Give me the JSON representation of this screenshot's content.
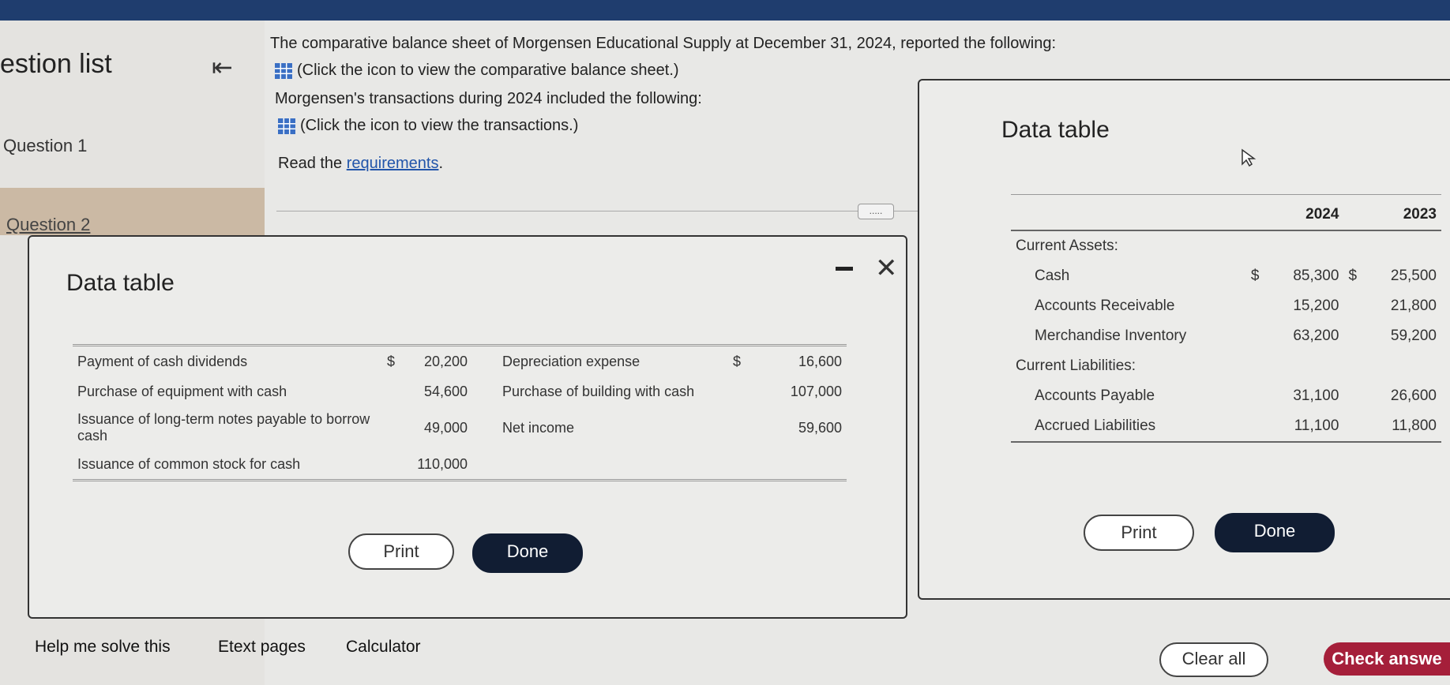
{
  "sidebar": {
    "title": "estion list",
    "items": [
      {
        "label": "Question 1"
      },
      {
        "label": "Question 2"
      }
    ]
  },
  "intro": {
    "line1": "The comparative balance sheet of Morgensen Educational Supply at December 31, 2024, reported the following:",
    "line2": "(Click the icon to view the comparative balance sheet.)",
    "line3": "Morgensen's transactions during 2024 included the following:",
    "line4": "(Click the icon to view the transactions.)",
    "read_prefix": "Read the ",
    "read_link": "requirements",
    "read_suffix": ".",
    "ellipsis": "....."
  },
  "modal_transactions": {
    "title": "Data table",
    "rows": [
      {
        "label1": "Payment of cash dividends",
        "cur1": "$",
        "val1": "20,200",
        "label2": "Depreciation expense",
        "cur2": "$",
        "val2": "16,600"
      },
      {
        "label1": "Purchase of equipment with cash",
        "cur1": "",
        "val1": "54,600",
        "label2": "Purchase of building with cash",
        "cur2": "",
        "val2": "107,000"
      },
      {
        "label1": "Issuance of long-term notes payable to borrow cash",
        "cur1": "",
        "val1": "49,000",
        "label2": "Net income",
        "cur2": "",
        "val2": "59,600"
      },
      {
        "label1": "Issuance of common stock for cash",
        "cur1": "",
        "val1": "110,000",
        "label2": "",
        "cur2": "",
        "val2": ""
      }
    ],
    "print_label": "Print",
    "done_label": "Done"
  },
  "modal_balance": {
    "title": "Data table",
    "col_2024": "2024",
    "col_2023": "2023",
    "sections": [
      {
        "heading": "Current Assets:",
        "rows": [
          {
            "label": "Cash",
            "cur1": "$",
            "v2024": "85,300",
            "cur2": "$",
            "v2023": "25,500"
          },
          {
            "label": "Accounts Receivable",
            "cur1": "",
            "v2024": "15,200",
            "cur2": "",
            "v2023": "21,800"
          },
          {
            "label": "Merchandise Inventory",
            "cur1": "",
            "v2024": "63,200",
            "cur2": "",
            "v2023": "59,200"
          }
        ]
      },
      {
        "heading": "Current Liabilities:",
        "rows": [
          {
            "label": "Accounts Payable",
            "cur1": "",
            "v2024": "31,100",
            "cur2": "",
            "v2023": "26,600"
          },
          {
            "label": "Accrued Liabilities",
            "cur1": "",
            "v2024": "11,100",
            "cur2": "",
            "v2023": "11,800"
          }
        ]
      }
    ],
    "print_label": "Print",
    "done_label": "Done"
  },
  "footer": {
    "help": "Help me solve this",
    "etext": "Etext pages",
    "calculator": "Calculator",
    "clear_all": "Clear all",
    "check_answer": "Check answe"
  },
  "icons": [
    "collapse-left-icon",
    "table-grid-icon",
    "close-icon",
    "minimize-icon",
    "mouse-cursor-icon"
  ],
  "colors": {
    "topbar": "#1f3d6e",
    "done_button": "#111d33",
    "check_button": "#a51f3a",
    "link": "#2255aa"
  }
}
